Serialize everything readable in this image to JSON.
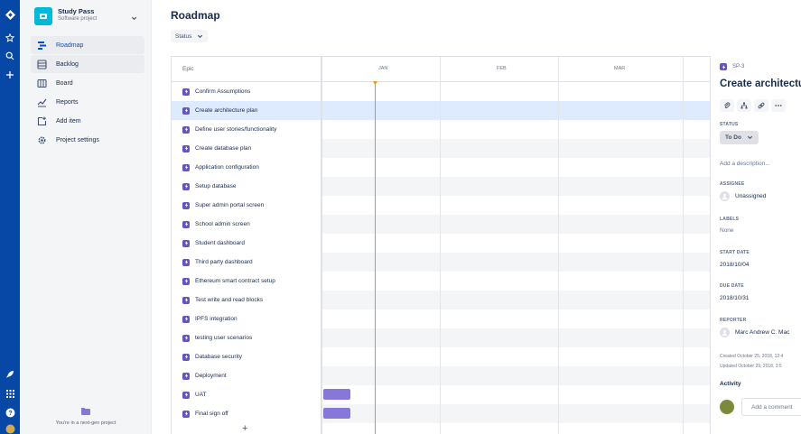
{
  "colors": {
    "global_nav": "#0747a6",
    "epic": "#6554c0",
    "bar": "#8777d9",
    "today_line": "#ff8b00",
    "selected_row": "#deebff"
  },
  "project": {
    "name": "Study Pass",
    "type": "Software project"
  },
  "sidebar": {
    "items": [
      {
        "label": "Roadmap",
        "icon": "roadmap-icon",
        "active": true
      },
      {
        "label": "Backlog",
        "icon": "backlog-icon",
        "active": false
      },
      {
        "label": "Board",
        "icon": "board-icon",
        "active": false
      },
      {
        "label": "Reports",
        "icon": "reports-icon",
        "active": false
      },
      {
        "label": "Add item",
        "icon": "add-item-icon",
        "active": false
      },
      {
        "label": "Project settings",
        "icon": "gear-icon",
        "active": false
      }
    ],
    "footer": "You're in a next-gen project"
  },
  "page": {
    "title": "Roadmap",
    "status_filter": "Status"
  },
  "roadmap": {
    "epic_header": "Epic",
    "months": [
      "JAN",
      "FEB",
      "MAR"
    ],
    "add_label": "+",
    "epics": [
      {
        "label": "Confirm Assumptions"
      },
      {
        "label": "Create architecture plan",
        "selected": true
      },
      {
        "label": "Define user stories/functionality"
      },
      {
        "label": "Create database plan"
      },
      {
        "label": "Application configuration"
      },
      {
        "label": "Setup database"
      },
      {
        "label": "Super admin portal screen"
      },
      {
        "label": "School admin screen"
      },
      {
        "label": "Student dashboard"
      },
      {
        "label": "Third party dashboard"
      },
      {
        "label": "Ethereum smart contract setup"
      },
      {
        "label": "Test write and read blocks"
      },
      {
        "label": "IPFS integration"
      },
      {
        "label": "testing user scenarios"
      },
      {
        "label": "Database security"
      },
      {
        "label": "Deployment"
      },
      {
        "label": "UAT",
        "has_bar": true
      },
      {
        "label": "Final sign off",
        "has_bar": true
      }
    ]
  },
  "detail": {
    "key": "SP-3",
    "title": "Create architecture plan",
    "status_label": "STATUS",
    "status_value": "To Do",
    "description_placeholder": "Add a description...",
    "assignee_label": "ASSIGNEE",
    "assignee_value": "Unassigned",
    "labels_label": "LABELS",
    "labels_value": "None",
    "start_label": "START DATE",
    "start_value": "2018/10/04",
    "due_label": "DUE DATE",
    "due_value": "2018/10/31",
    "reporter_label": "REPORTER",
    "reporter_value": "Marc Andrew C. Mac",
    "created": "Created October 25, 2018, 12:4",
    "updated": "Updated October 29, 2018, 3:5",
    "activity_label": "Activity",
    "comment_placeholder": "Add a comment"
  }
}
